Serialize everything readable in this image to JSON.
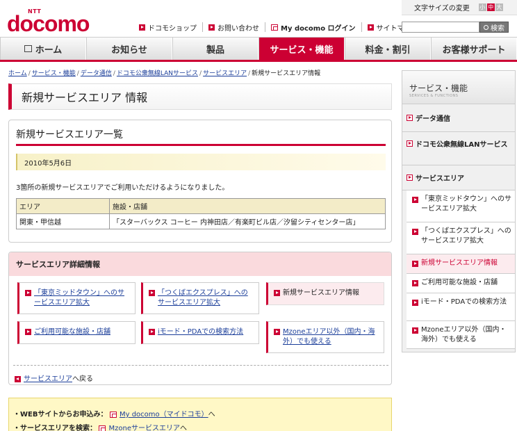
{
  "header": {
    "logo_small": "NTT",
    "logo_text": "docomo",
    "util_links": [
      "ドコモショップ",
      "お問い合わせ",
      "My docomo ログイン",
      "サイトマップ"
    ],
    "font_size_label": "文字サイズの変更",
    "font_sizes": [
      "小",
      "中",
      "大"
    ],
    "search_placeholder": "",
    "search_button": "検索"
  },
  "nav": {
    "tabs": [
      "ホーム",
      "お知らせ",
      "製品",
      "サービス・機能",
      "料金・割引",
      "お客様サポート"
    ],
    "active": "サービス・機能"
  },
  "breadcrumb": {
    "links": [
      "ホーム",
      "サービス・機能",
      "データ通信",
      "ドコモ公衆無線LANサービス",
      "サービスエリア"
    ],
    "current": "新規サービスエリア情報"
  },
  "page_title": "新規サービスエリア 情報",
  "list_section": {
    "heading": "新規サービスエリア一覧",
    "date": "2010年5月6日",
    "description": "3箇所の新規サービスエリアでご利用いただけるようになりました。",
    "table": {
      "headers": [
        "エリア",
        "施設・店舗"
      ],
      "rows": [
        [
          "関東・甲信越",
          "「スターバックス コーヒー 内神田店／有楽町ビル店／汐留シティセンター店」"
        ]
      ]
    }
  },
  "detail_section": {
    "heading": "サービスエリア詳細情報",
    "cards": [
      "「東京ミッドタウン」へのサービスエリア拡大",
      "「つくばエクスプレス」へのサービスエリア拡大",
      "新規サービスエリア情報",
      "ご利用可能な施設・店舗",
      "iモード・PDAでの検索方法",
      "Mzoneエリア以外（国内・海外）でも使える"
    ],
    "back_link": "サービスエリア",
    "back_suffix": "へ戻る"
  },
  "bottom_box": {
    "row1_label": "WEBサイトからお申込み：",
    "row1_link": "My docomo（マイドコモ）",
    "row1_suffix": "へ",
    "row2_label": "サービスエリアを検索：",
    "row2_link": "Mzoneサービスエリア",
    "row2_suffix": "へ"
  },
  "sidebar": {
    "title": "サービス・機能",
    "subtitle": "SERVICES & FUNCTIONS",
    "categories": [
      "データ通信",
      "ドコモ公衆無線LANサービス",
      "サービスエリア"
    ],
    "sub_items": [
      "「東京ミッドタウン」へのサービスエリア拡大",
      "「つくばエクスプレス」へのサービスエリア拡大",
      "新規サービスエリア情報",
      "ご利用可能な施設・店舗",
      "iモード・PDAでの検索方法",
      "Mzoneエリア以外（国内・海外）でも使える"
    ],
    "current_sub": "新規サービスエリア情報"
  },
  "colors": {
    "brand": "#cc0033",
    "highlight": "#fcebee",
    "yellow": "#fff8c6"
  }
}
